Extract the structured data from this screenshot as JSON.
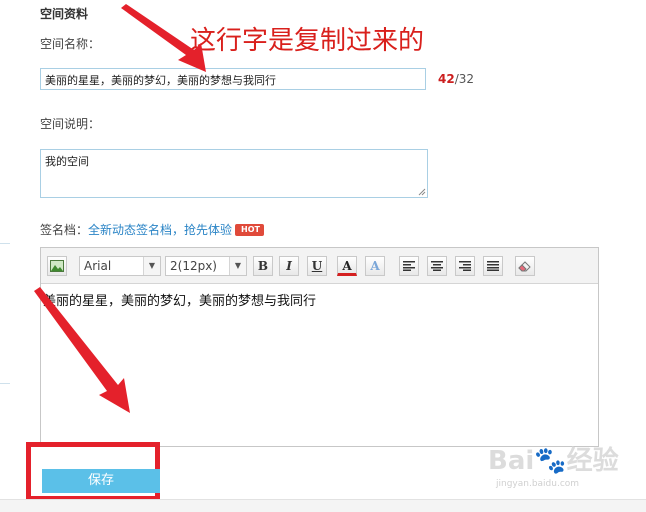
{
  "section": {
    "title": "空间资料"
  },
  "space_name": {
    "label": "空间名称：",
    "value": "美丽的星星，美丽的梦幻，美丽的梦想与我同行",
    "count_current": "42",
    "count_sep_max": "/32"
  },
  "space_desc": {
    "label": "空间说明：",
    "value": "我的空间"
  },
  "signature": {
    "label": "签名档：",
    "link": "全新动态签名档，抢先体验",
    "badge": "HOT"
  },
  "editor": {
    "font_value": "Arial",
    "size_value": "2(12px)",
    "bold": "B",
    "italic": "I",
    "underline": "U",
    "font_color": "A",
    "highlight": "A",
    "content": "美丽的星星，美丽的梦幻，美丽的梦想与我同行"
  },
  "save": {
    "label": "保存"
  },
  "annotation": {
    "text": "这行字是复制过来的"
  },
  "watermark": {
    "main": "Bai🐾经验",
    "sub": "jingyan.baidu.com"
  },
  "colors": {
    "accent": "#5bc0e8",
    "annotation": "#e4212b",
    "counter": "#cc1f1f",
    "link": "#2a84c6"
  }
}
